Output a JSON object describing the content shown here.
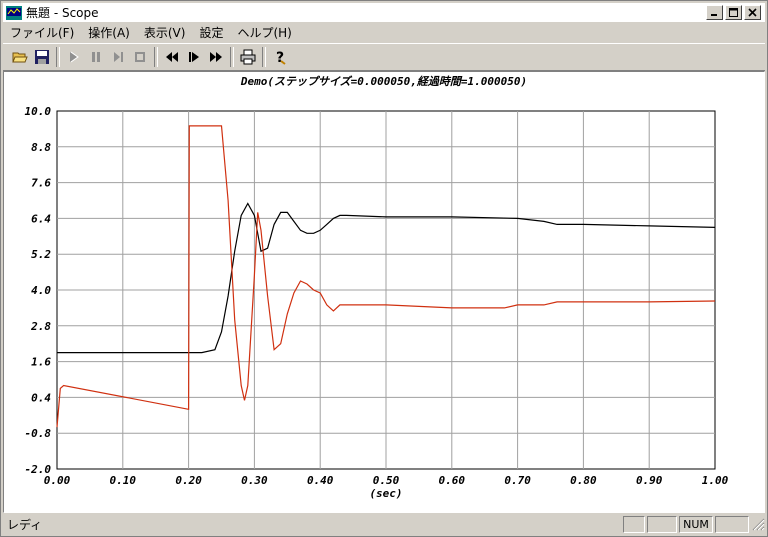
{
  "window": {
    "title": "無題 - Scope",
    "min_label": "_",
    "max_label": "□",
    "close_label": "×"
  },
  "menu": [
    {
      "label": "ファイル(F)"
    },
    {
      "label": "操作(A)"
    },
    {
      "label": "表示(V)"
    },
    {
      "label": "設定"
    },
    {
      "label": "ヘルプ(H)"
    }
  ],
  "toolbar": [
    "open-icon",
    "save-icon",
    "run-icon",
    "pause-icon",
    "step-icon",
    "stop-icon",
    "rewind-icon",
    "play-icon",
    "fast-forward-icon",
    "print-icon",
    "help-icon"
  ],
  "plot": {
    "title": "Demo(ステップサイズ=0.000050,経過時間=1.000050)"
  },
  "chart_data": {
    "type": "line",
    "xlabel": "(sec)",
    "ylabel": "",
    "xlim": [
      0.0,
      1.0
    ],
    "ylim": [
      -2.0,
      10.0
    ],
    "xticks": [
      "0.00",
      "0.10",
      "0.20",
      "0.30",
      "0.40",
      "0.50",
      "0.60",
      "0.70",
      "0.80",
      "0.90",
      "1.00"
    ],
    "yticks": [
      "10.0",
      "8.8",
      "7.6",
      "6.4",
      "5.2",
      "4.0",
      "2.8",
      "1.6",
      "0.4",
      "-0.8",
      "-2.0"
    ],
    "grid": true,
    "series": [
      {
        "color": "#000000",
        "x": [
          0.0,
          0.2,
          0.22,
          0.24,
          0.25,
          0.26,
          0.27,
          0.28,
          0.29,
          0.3,
          0.31,
          0.32,
          0.33,
          0.34,
          0.35,
          0.36,
          0.37,
          0.38,
          0.39,
          0.4,
          0.41,
          0.42,
          0.43,
          0.44,
          0.5,
          0.6,
          0.7,
          0.74,
          0.76,
          0.8,
          0.9,
          1.0
        ],
        "y": [
          1.9,
          1.9,
          1.9,
          2.0,
          2.6,
          3.8,
          5.3,
          6.5,
          6.9,
          6.5,
          5.3,
          5.4,
          6.2,
          6.6,
          6.6,
          6.3,
          6.0,
          5.9,
          5.9,
          6.0,
          6.2,
          6.4,
          6.5,
          6.5,
          6.45,
          6.45,
          6.4,
          6.3,
          6.2,
          6.2,
          6.15,
          6.1
        ]
      },
      {
        "color": "#d03010",
        "x": [
          0.0,
          0.005,
          0.01,
          0.2,
          0.201,
          0.25,
          0.26,
          0.27,
          0.28,
          0.285,
          0.29,
          0.3,
          0.305,
          0.31,
          0.32,
          0.33,
          0.34,
          0.35,
          0.36,
          0.37,
          0.38,
          0.39,
          0.4,
          0.41,
          0.42,
          0.43,
          0.44,
          0.5,
          0.6,
          0.68,
          0.7,
          0.72,
          0.74,
          0.76,
          0.8,
          0.9,
          1.0
        ],
        "y": [
          -0.6,
          0.7,
          0.8,
          0.0,
          9.5,
          9.5,
          7.0,
          3.0,
          0.8,
          0.3,
          0.8,
          4.5,
          6.6,
          6.0,
          3.8,
          2.0,
          2.2,
          3.2,
          3.9,
          4.3,
          4.2,
          4.0,
          3.9,
          3.5,
          3.3,
          3.5,
          3.5,
          3.5,
          3.4,
          3.4,
          3.5,
          3.5,
          3.5,
          3.6,
          3.6,
          3.6,
          3.63
        ]
      }
    ]
  },
  "status": {
    "text": "レディ",
    "num": "NUM"
  }
}
